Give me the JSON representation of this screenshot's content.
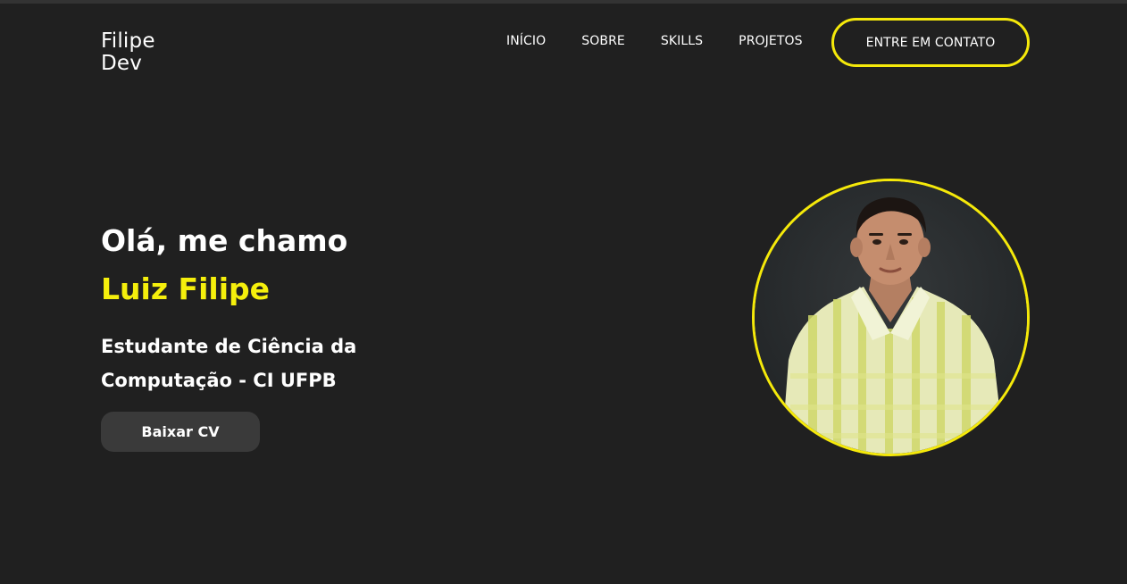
{
  "header": {
    "logo_line1": "Filipe",
    "logo_line2": "Dev",
    "nav": [
      {
        "label": "INÍCIO"
      },
      {
        "label": "SOBRE"
      },
      {
        "label": "SKILLS"
      },
      {
        "label": "PROJETOS"
      }
    ],
    "contact_label": "ENTRE EM CONTATO"
  },
  "hero": {
    "greeting": "Olá, me chamo",
    "name": "Luiz Filipe",
    "subtitle_line1": "Estudante de Ciência da",
    "subtitle_line2": "Computação - CI UFPB",
    "cv_label": "Baixar CV"
  },
  "colors": {
    "background": "#202020",
    "accent": "#f5ef0c",
    "button_bg": "#3a3a3a",
    "text": "#ffffff"
  }
}
